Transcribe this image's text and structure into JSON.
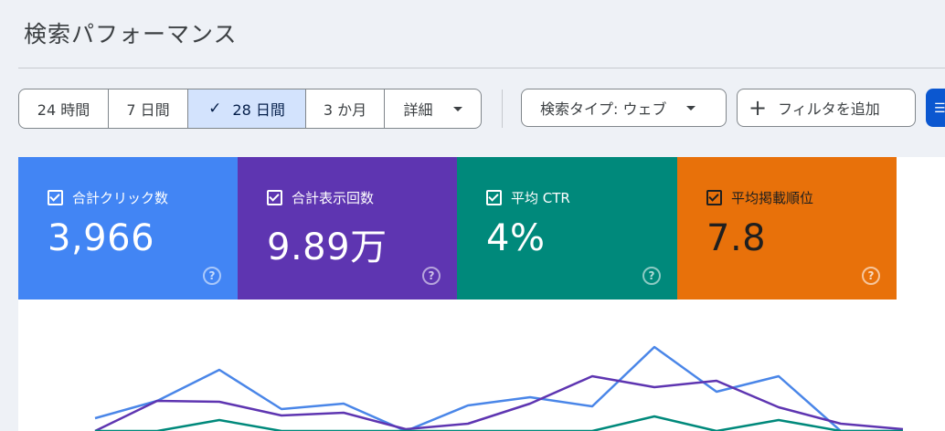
{
  "page": {
    "title": "検索パフォーマンス"
  },
  "date_range": {
    "options": [
      "24 時間",
      "7 日間",
      "28 日間",
      "3 か月",
      "詳細"
    ],
    "selected": "28 日間",
    "selected_check": "✓"
  },
  "filters": {
    "search_type": "検索タイプ: ウェブ",
    "add_filter_label": "フィルタを追加",
    "add_filter_icon": "+"
  },
  "metrics": [
    {
      "label": "合計クリック数",
      "value": "3,966",
      "color": "#4285f4",
      "checked": true
    },
    {
      "label": "合計表示回数",
      "value": "9.89万",
      "color": "#5e35b1",
      "checked": true
    },
    {
      "label": "平均 CTR",
      "value": "4%",
      "color": "#00897b",
      "checked": true
    },
    {
      "label": "平均掲載順位",
      "value": "7.8",
      "color": "#e8710a",
      "checked": true
    }
  ],
  "help_icon": "?",
  "chart_data": {
    "type": "line",
    "x": [
      0,
      1,
      2,
      3,
      4,
      5,
      6,
      7,
      8,
      9,
      10,
      11,
      12,
      13
    ],
    "series": [
      {
        "name": "合計クリック数",
        "color": "#4a86e8",
        "values": [
          14,
          33,
          67,
          24,
          30,
          0,
          28,
          37,
          27,
          92,
          43,
          60,
          0,
          0
        ]
      },
      {
        "name": "合計表示回数",
        "color": "#5e35b1",
        "values": [
          0,
          33,
          32,
          17,
          20,
          2,
          8,
          30,
          60,
          48,
          55,
          26,
          8,
          2
        ]
      },
      {
        "name": "平均 CTR",
        "color": "#00897b",
        "values": [
          0,
          0,
          12,
          0,
          0,
          0,
          0,
          0,
          0,
          16,
          0,
          12,
          0,
          0
        ]
      }
    ]
  }
}
